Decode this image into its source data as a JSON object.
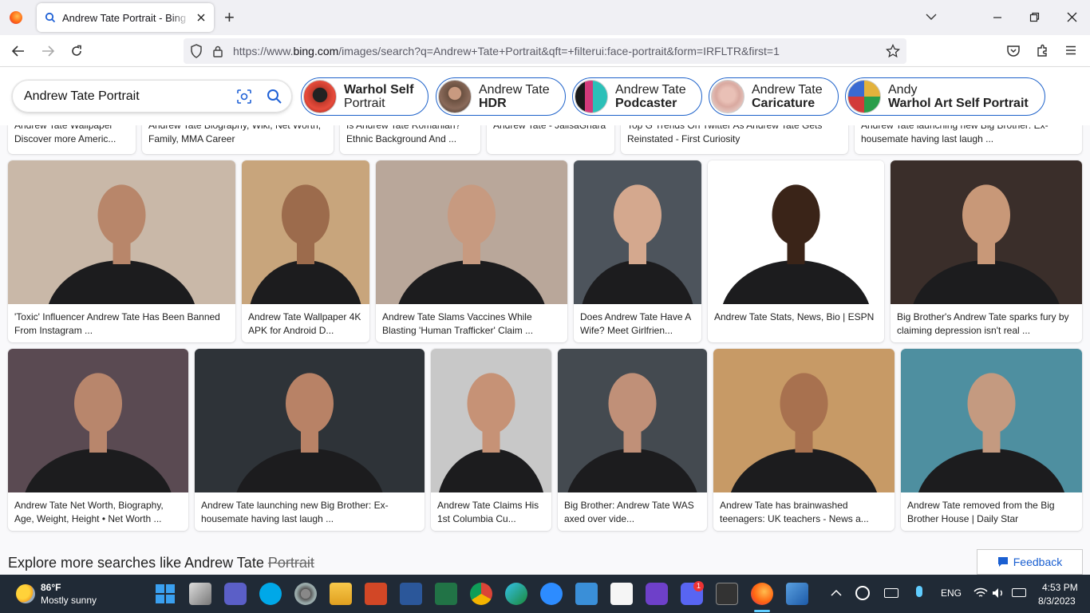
{
  "browser": {
    "tab_title": "Andrew Tate Portrait - Bing images",
    "url_prefix": "https://www.",
    "url_domain": "bing.com",
    "url_rest": "/images/search?q=Andrew+Tate+Portrait&qft=+filterui:face-portrait&form=IRFLTR&first=1",
    "new_tab_label": "+"
  },
  "bing": {
    "search_value": "Andrew Tate Portrait",
    "chips": [
      {
        "line1": "Warhol Self",
        "line2": "Portrait",
        "bold": "line1",
        "color": "#c0392b"
      },
      {
        "line1": "Andrew Tate",
        "line2": "HDR",
        "bold": "line2",
        "color": "#8a6a5a"
      },
      {
        "line1": "Andrew Tate",
        "line2": "Podcaster",
        "bold": "line2",
        "color": "#d23a7a"
      },
      {
        "line1": "Andrew Tate",
        "line2": "Caricature",
        "bold": "line2",
        "color": "#d9a9a0"
      },
      {
        "line1": "Andy",
        "line2": "Warhol Art Self Portrait",
        "bold": "line2",
        "color": "#e3b23c"
      }
    ]
  },
  "top_row": [
    "Andrew Tate Wallpaper Discover more Americ...",
    "Andrew Tate Biography, Wiki, Net Worth, Family, MMA Career",
    "Is Andrew Tate Romanian? Ethnic Background And ...",
    "Andrew Tate - JalisaGhara",
    "Top G Trends On Twitter As Andrew Tate Gets Reinstated - First Curiosity",
    "Andrew Tate launching new Big Brother: Ex-housemate having last laugh ..."
  ],
  "row1": [
    {
      "caption": "'Toxic' Influencer Andrew Tate Has Been Banned From Instagram ...",
      "bg": "#c9b8a8",
      "skin": "#b8866a"
    },
    {
      "caption": "Andrew Tate Wallpaper 4K APK for Android D...",
      "bg": "#c8a57c",
      "skin": "#9c6b4c"
    },
    {
      "caption": "Andrew Tate Slams Vaccines While Blasting 'Human Trafficker' Claim ...",
      "bg": "#b9a79a",
      "skin": "#c79a80"
    },
    {
      "caption": "Does Andrew Tate Have A Wife? Meet Girlfrien...",
      "bg": "#4d545c",
      "skin": "#d4a88e"
    },
    {
      "caption": "Andrew Tate Stats, News, Bio | ESPN",
      "bg": "#ffffff",
      "skin": "#3a2418"
    },
    {
      "caption": "Big Brother's Andrew Tate sparks fury by claiming depression isn't real ...",
      "bg": "#3a2e2a",
      "skin": "#c89878"
    }
  ],
  "row2": [
    {
      "caption": "Andrew Tate Net Worth, Biography, Age, Weight, Height • Net Worth ...",
      "bg": "#5a4a52",
      "skin": "#b8866c"
    },
    {
      "caption": "Andrew Tate launching new Big Brother: Ex-housemate having last laugh ...",
      "bg": "#2e3338",
      "skin": "#b88266"
    },
    {
      "caption": "Andrew Tate Claims His 1st Columbia Cu...",
      "bg": "#c8c8c8",
      "skin": "#c69276"
    },
    {
      "caption": "Big Brother: Andrew Tate WAS axed over vide...",
      "bg": "#444a50",
      "skin": "#c09078"
    },
    {
      "caption": "Andrew Tate has brainwashed teenagers: UK teachers - News a...",
      "bg": "#c79a66",
      "skin": "#a8714f"
    },
    {
      "caption": "Andrew Tate removed from the Big Brother House | Daily Star",
      "bg": "#4e8fa0",
      "skin": "#c49a80"
    }
  ],
  "explore": {
    "prefix": "Explore more searches like Andrew Tate ",
    "struck": "Portrait"
  },
  "feedback_label": "Feedback",
  "taskbar": {
    "temp": "86°F",
    "weather": "Mostly sunny",
    "lang": "ENG",
    "time": "4:53 PM",
    "date": "8/3/2023",
    "discord_badge": "1"
  }
}
